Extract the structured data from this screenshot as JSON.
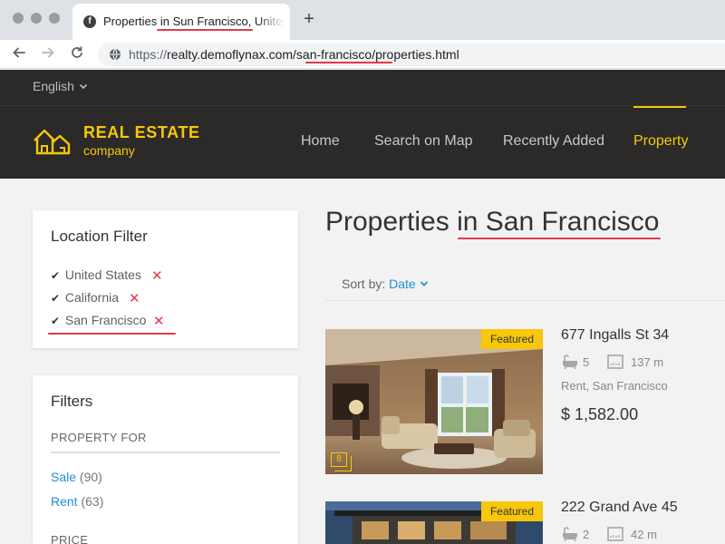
{
  "browser": {
    "tab_title": "Properties in Sun Francisco, United States",
    "favicon_letter": "f",
    "new_tab_label": "+",
    "url_scheme": "https://",
    "url_host": "realty.demoflynax.com",
    "url_path": "/san-francisco/properties.html",
    "back_icon": "arrow-left-icon",
    "forward_icon": "arrow-right-icon",
    "reload_icon": "reload-icon"
  },
  "site": {
    "language": "English",
    "logo_title": "REAL ESTATE",
    "logo_subtitle": "company",
    "nav": [
      {
        "label": "Home",
        "active": false
      },
      {
        "label": "Search on Map",
        "active": false
      },
      {
        "label": "Recently Added",
        "active": false
      },
      {
        "label": "Property",
        "active": true
      }
    ]
  },
  "location_filter": {
    "title": "Location Filter",
    "items": [
      "United States",
      "California",
      "San Francisco"
    ]
  },
  "filters": {
    "title": "Filters",
    "groups": [
      {
        "label": "PROPERTY FOR",
        "options": [
          {
            "label": "Sale",
            "count": "(90)"
          },
          {
            "label": "Rent",
            "count": "(63)"
          }
        ]
      },
      {
        "label": "PRICE",
        "options": []
      }
    ]
  },
  "main": {
    "title": "Properties in San Francisco",
    "sort_label": "Sort by:",
    "sort_value": "Date"
  },
  "listings": [
    {
      "featured": "Featured",
      "photos": "8",
      "title": "677 Ingalls St 34",
      "bathrooms": "5",
      "area": "137 m",
      "type": "Rent, San Francisco",
      "price": "$ 1,582.00"
    },
    {
      "featured": "Featured",
      "title": "222 Grand Ave 45",
      "bathrooms": "2",
      "area": "42 m"
    }
  ],
  "colors": {
    "accent": "#f8c70a",
    "header_bg": "#2b2a29",
    "link": "#1f8fd6",
    "highlight_underline": "#e23b49",
    "remove": "#e23b49"
  }
}
